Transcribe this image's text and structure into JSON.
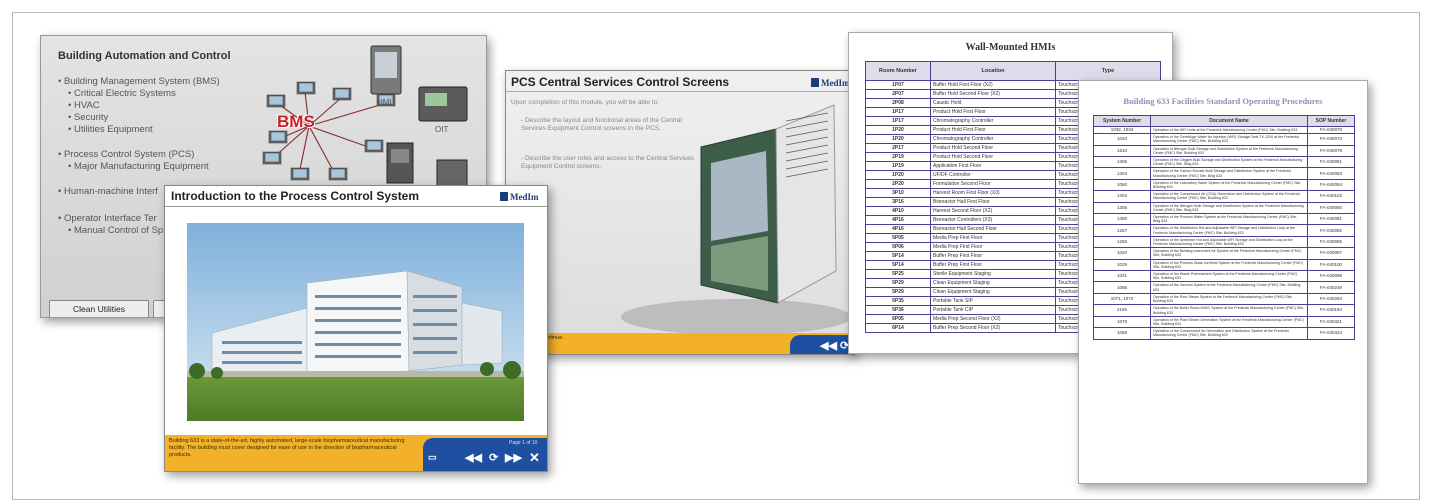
{
  "slide_bms": {
    "title": "Building Automation and Control",
    "bullets": [
      {
        "text": "• Building Management System (BMS)",
        "sub": false
      },
      {
        "text": "• Critical Electric Systems",
        "sub": true
      },
      {
        "text": "• HVAC",
        "sub": true
      },
      {
        "text": "• Security",
        "sub": true
      },
      {
        "text": "• Utilities Equipment",
        "sub": true
      },
      {
        "text": "• Process Control System (PCS)",
        "sub": false
      },
      {
        "text": "• Major Manufacturing Equipment",
        "sub": true
      },
      {
        "text": "• Human-machine Interf",
        "sub": false
      },
      {
        "text": "• Operator Interface Ter",
        "sub": false
      },
      {
        "text": "• Manual Control of Sp",
        "sub": true
      }
    ],
    "hub_label": "BMS",
    "hmi_label": "HMI",
    "oit_label": "OIT",
    "button_label": "Clean Utilities"
  },
  "slide_intro": {
    "title": "Introduction to the Process Control System",
    "logo_text": "MedIm",
    "caption": "Building 633 is a state-of-the-art, highly automated, large-scale biopharmaceutical manufacturing facility. The building must cover designed for ease of use in the direction of biopharmaceutical products.",
    "page_text": "Page 1 of 10"
  },
  "slide_pcs": {
    "title": "PCS Central Services Control Screens",
    "logo_text": "MedIm",
    "intro": "Upon completion of this module, you will be able to:",
    "points": [
      "- Describe the layout and functional areas of the Central Services Equipment Control screens in the PCS.",
      "- Describe the user roles and access to the Central Services Equipment Control screens."
    ],
    "caption": "Click next to continue."
  },
  "doc_hmi": {
    "title": "Wall-Mounted HMIs",
    "headers": [
      "Room Number",
      "Location",
      "Type"
    ],
    "rows": [
      [
        "1P07",
        "Buffer Hold First Floor (X2)",
        "Touchscreen"
      ],
      [
        "2P07",
        "Buffer Hold Second Floor (X2)",
        "Touchscreen"
      ],
      [
        "2P08",
        "Caustic Hold",
        "Touchscreen"
      ],
      [
        "1P17",
        "Product Hold First Floor",
        "Touchscreen"
      ],
      [
        "1P17",
        "Chromatography Controller",
        "Touchscreen"
      ],
      [
        "1P20",
        "Product Hold First Floor",
        "Touchscreen"
      ],
      [
        "1P20",
        "Chromatography Controller",
        "Touchscreen"
      ],
      [
        "2P17",
        "Product Hold Second Floor",
        "Touchscreen"
      ],
      [
        "2P19",
        "Product Hold Second Floor",
        "Touchscreen"
      ],
      [
        "1P19",
        "Application First Floor",
        "Touchscreen"
      ],
      [
        "1P20",
        "UF/DF Controller",
        "Touchscreen"
      ],
      [
        "2P20",
        "Formulation Second Floor",
        "Touchscreen"
      ],
      [
        "3P10",
        "Harvest Room First Floor (X3)",
        "Touchscreen"
      ],
      [
        "3P16",
        "Bioreactor Hall First Floor",
        "Touchscreen"
      ],
      [
        "4P10",
        "Harvest Second Floor (X2)",
        "Touchscreen"
      ],
      [
        "4P16",
        "Bioreactor Controllers (X3)",
        "Touchscreen"
      ],
      [
        "4P16",
        "Bioreactor Hall Second Floor",
        "Touchscreen"
      ],
      [
        "5P05",
        "Media Prep First Floor",
        "Touchscreen"
      ],
      [
        "5P06",
        "Media Prep First Floor",
        "Touchscreen"
      ],
      [
        "5P14",
        "Buffer Prep First Floor",
        "Touchscreen"
      ],
      [
        "5P14",
        "Buffer Prep First Floor",
        "Touchscreen"
      ],
      [
        "5P25",
        "Sterile Equipment Staging",
        "Touchscreen"
      ],
      [
        "5P29",
        "Clean Equipment Staging",
        "Touchscreen"
      ],
      [
        "5P29",
        "Clean Equipment Staging",
        "Touchscreen"
      ],
      [
        "5P35",
        "Portable Tank SIP",
        "Touchscreen"
      ],
      [
        "5P36",
        "Portable Tank CIP",
        "Touchscreen"
      ],
      [
        "6P05",
        "Media Prep Second Floor (X2)",
        "Touchscreen"
      ],
      [
        "6P14",
        "Buffer Prep Second Floor (X2)",
        "Touchscreen"
      ]
    ]
  },
  "doc_sop": {
    "title": "Building 633 Facilities Standard Operating Procedures",
    "headers": [
      "System Number",
      "Document Name",
      "SOP Number"
    ],
    "rows": [
      [
        "1032, 1034",
        "Operation of the WFI Units at the Frederick Manufacturing Center (FMC) Site, Building 633",
        "FA-040070"
      ],
      [
        "1033",
        "Operation of the Centrifuge Water for Injection (WFI) Storage Tank TK-1200 at the Frederick Manufacturing Center (FMC) Site, Building 633",
        "FA-040073"
      ],
      [
        "1510",
        "Operation of Nitrogen Bulk Storage and Distribution System at the Frederick Manufacturing Center (FMC) Site, Building 633",
        "FA-040079"
      ],
      [
        "1306",
        "Operation of the Oxygen Bulk Storage and Distribution System at the Frederick Manufacturing Center (FMC) Site, Bldg 633",
        "FA-040081"
      ],
      [
        "1304",
        "Operation of the Carbon Dioxide Bulk Storage and Distribution System at the Frederick Manufacturing Center (FMC) Site, Bldg 633",
        "FA-040083"
      ],
      [
        "1060",
        "Operation of the Laboratory Water System at the Frederick Manufacturing Center (FMC) Site, Building 633",
        "FA-040084"
      ],
      [
        "1403",
        "Operation of the Compressed Air (CDA) Generation and Distribution System at the Frederick Manufacturing Center (FMC) Site, Building 633",
        "FA-040102"
      ],
      [
        "1305",
        "Operation of the Nitrogen Bulk Storage and Distribution System at the Frederick Manufacturing Center (FMC) Site, Bldg 633",
        "FA-040080"
      ],
      [
        "1400",
        "Operation of the Process Water System at the Frederick Manufacturing Center (FMC) Site, Bldg 633",
        "FA-040081"
      ],
      [
        "1257",
        "Operation of the Distribution Hot and Adjustable WFI Storage and Distribution Loop at the Frederick Manufacturing Center (FMC) Site, Building 633",
        "FA-040082"
      ],
      [
        "1256",
        "Operation of the Upstream Hot and Adjustable WFI Storage and Distribution Loop at the Frederick Manufacturing Center (FMC) Site, Building 633",
        "FA-040085"
      ],
      [
        "1020",
        "Operation of the Building Instrument Air System at the Frederick Manufacturing Center (FMC) Site, Building 633",
        "FA-040097"
      ],
      [
        "1029",
        "Operation of the Process Glass Ice/Heat System at the Frederick Manufacturing Center (FMC) Site, Building 633",
        "FA-040100"
      ],
      [
        "1031",
        "Operation of the Waste Pretreatment System at the Frederick Manufacturing Center (FMC) Site, Building 633",
        "FA-040098"
      ],
      [
        "1065",
        "Operation of the Vacuum System at the Frederick Manufacturing Center (FMC) Site, Building 633",
        "FA-040249"
      ],
      [
        "1071, 1072",
        "Operation of the Pure Steam System at the Frederick Manufacturing Center (FMC) Site, Building 633",
        "FA-040264"
      ],
      [
        "2165",
        "Operation of the Boiler Room HVAC System at the Frederick Manufacturing Center (FMC) Site, Building 633",
        "FA-040194"
      ],
      [
        "1078",
        "Operation of the Plant Steam Generation System at the Frederick Manufacturing Center (FMC) Site, Building 633",
        "FA-040321"
      ],
      [
        "1068",
        "Operation of the Compressed Air Generation and Distribution System at the Frederick Manufacturing Center (FMC) Site, Building 633",
        "FA-040324"
      ]
    ]
  },
  "colors": {
    "accent": "#1e4fa0",
    "caption": "#f3b12a",
    "hub": "#c8202a",
    "table_border": "#4a3f8f"
  }
}
